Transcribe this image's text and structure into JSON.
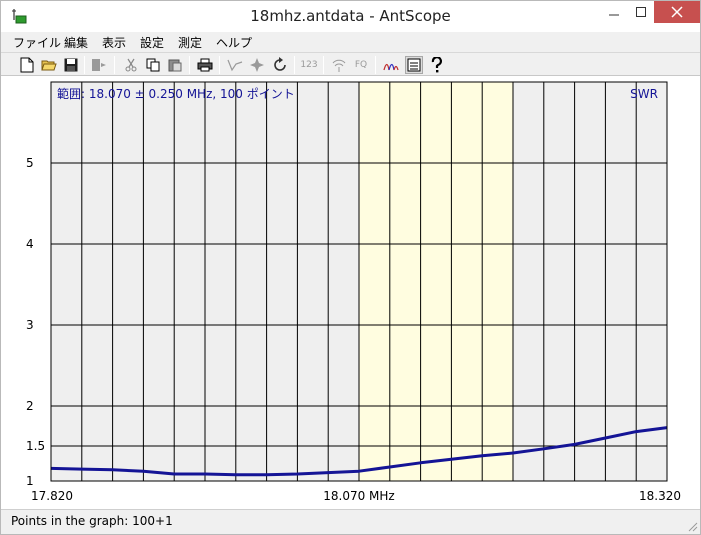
{
  "window": {
    "title": "18mhz.antdata - AntScope",
    "close_color": "#c7504f"
  },
  "menu": {
    "items": [
      "ファイル",
      "編集",
      "表示",
      "設定",
      "測定",
      "ヘルプ"
    ]
  },
  "toolbar": {
    "buttons": [
      {
        "icon": "new-file-icon"
      },
      {
        "icon": "open-folder-icon"
      },
      {
        "icon": "save-disk-icon"
      },
      {
        "icon": "export-icon"
      },
      {
        "icon": "cut-icon"
      },
      {
        "icon": "copy-icon"
      },
      {
        "icon": "paste-icon"
      },
      {
        "icon": "print-icon"
      },
      {
        "icon": "single-scan-icon"
      },
      {
        "icon": "star-icon"
      },
      {
        "icon": "refresh-icon"
      },
      {
        "icon": "numeric-icon",
        "text": "123"
      },
      {
        "icon": "wireless-icon"
      },
      {
        "icon": "frequency-icon",
        "text": "FQ"
      },
      {
        "icon": "waveform-icon"
      },
      {
        "icon": "list-view-icon"
      },
      {
        "icon": "help-icon"
      }
    ]
  },
  "chart_data": {
    "type": "line",
    "range_label": "範囲: 18.070 ± 0.250 MHz, 100 ポイント",
    "series_label": "SWR",
    "series_color": "#141496",
    "highlight_color": "#fffde0",
    "highlight_x": [
      18.07,
      18.195
    ],
    "xlim": [
      17.82,
      18.32
    ],
    "x_ticks": [
      "17.820",
      "18.070 MHz",
      "18.320"
    ],
    "ylim": [
      1,
      6
    ],
    "y_ticks": [
      {
        "value": 1,
        "label": "1"
      },
      {
        "value": 1.5,
        "label": "1.5"
      },
      {
        "value": 2,
        "label": "2"
      },
      {
        "value": 3,
        "label": "3"
      },
      {
        "value": 4,
        "label": "4"
      },
      {
        "value": 5,
        "label": "5"
      }
    ],
    "grid": true,
    "x": [
      17.82,
      17.845,
      17.87,
      17.895,
      17.92,
      17.945,
      17.97,
      17.995,
      18.02,
      18.045,
      18.07,
      18.095,
      18.12,
      18.145,
      18.17,
      18.195,
      18.22,
      18.245,
      18.27,
      18.295,
      18.32
    ],
    "y": [
      1.18,
      1.17,
      1.16,
      1.14,
      1.1,
      1.1,
      1.09,
      1.09,
      1.1,
      1.12,
      1.14,
      1.2,
      1.26,
      1.31,
      1.36,
      1.4,
      1.46,
      1.52,
      1.6,
      1.68,
      1.73
    ]
  },
  "status": {
    "text": "Points in the graph: 100+1"
  }
}
